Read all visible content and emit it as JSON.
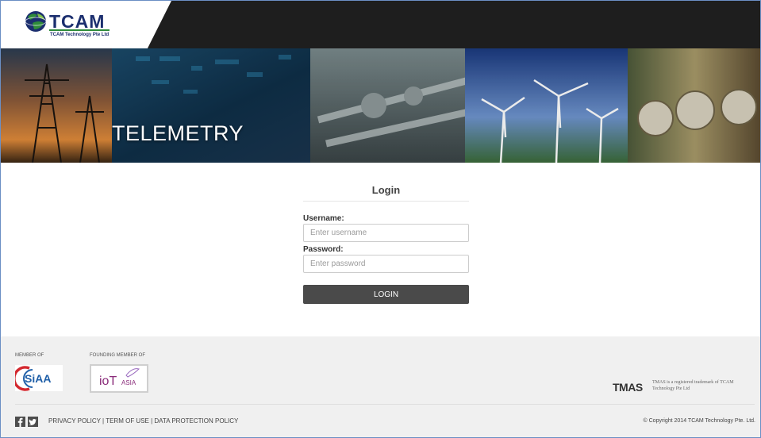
{
  "header": {
    "logo_text": "TCAM",
    "logo_subtitle": "TCAM Technology Pte Ltd"
  },
  "banner": {
    "title": "TELEMETRY"
  },
  "login": {
    "title": "Login",
    "username_label": "Username:",
    "username_placeholder": "Enter username",
    "username_value": "",
    "password_label": "Password:",
    "password_placeholder": "Enter password",
    "password_value": "",
    "button_label": "LOGIN"
  },
  "footer": {
    "member_of_label": "MEMBER OF",
    "founding_member_label": "FOUNDING MEMBER OF",
    "siaa_logo_text": "SiAA",
    "iot_logo_text_main": "ioT",
    "iot_logo_text_sub": "ASIA",
    "tmas_mark": "TMAS",
    "tmas_note": "TMAS is a registered trademark of TCAM Technology Pte Ltd",
    "social_icons": [
      "facebook-icon",
      "twitter-icon"
    ],
    "links": [
      {
        "label": "PRIVACY POLICY"
      },
      {
        "label": "TERM OF USE"
      },
      {
        "label": "DATA PROTECTION POLICY"
      }
    ],
    "link_separator": " | ",
    "copyright": "© Copyright 2014 TCAM Technology Pte. Ltd."
  },
  "colors": {
    "topbar": "#1e1e1e",
    "brand_navy": "#1b2e6e",
    "brand_green": "#2e8b3a",
    "login_button": "#4a4a4a",
    "footer_bg": "#f0f0f0"
  }
}
